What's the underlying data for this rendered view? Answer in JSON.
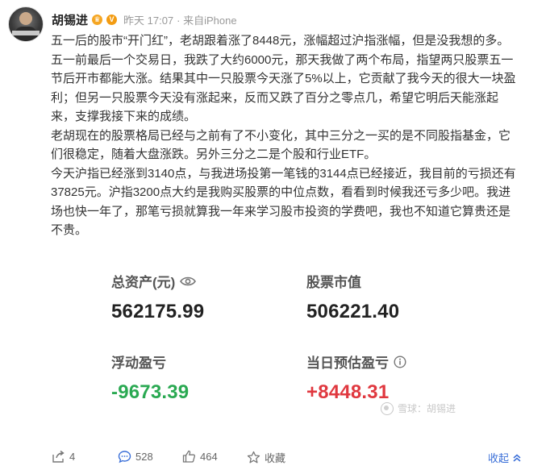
{
  "post": {
    "author": "胡锡进",
    "time": "昨天 17:07",
    "source": "· 来自iPhone",
    "paragraphs": [
      "五一后的股市“开门红”，老胡跟着涨了8448元，涨幅超过沪指涨幅，但是没我想的多。",
      "五一前最后一个交易日，我跌了大约6000元，那天我做了两个布局，指望两只股票五一节后开市都能大涨。结果其中一只股票今天涨了5%以上，它贡献了我今天的很大一块盈利；但另一只股票今天没有涨起来，反而又跌了百分之零点几，希望它明后天能涨起来，支撑我接下来的成绩。",
      "老胡现在的股票格局已经与之前有了不小变化，其中三分之一买的是不同股指基金，它们很稳定，随着大盘涨跌。另外三分之二是个股和行业ETF。",
      "今天沪指已经涨到3140点，与我进场投第一笔钱的3144点已经接近，我目前的亏损还有37825元。沪指3200点大约是我购买股票的中位点数，看看到时候我还亏多少吧。我进场也快一年了，那笔亏损就算我一年来学习股市投资的学费吧，我也不知道它算贵还是不贵。"
    ]
  },
  "stats": {
    "total_assets_label": "总资产(元)",
    "total_assets_value": "562175.99",
    "stock_value_label": "股票市值",
    "stock_value_value": "506221.40",
    "floating_pl_label": "浮动盈亏",
    "floating_pl_value": "-9673.39",
    "daily_pl_label": "当日预估盈亏",
    "daily_pl_value": "+8448.31"
  },
  "watermark": "雪球：胡锡进",
  "actions": {
    "repost_count": "4",
    "comment_count": "528",
    "like_count": "464",
    "favorite_label": "收藏",
    "collapse_label": "收起"
  },
  "colors": {
    "negative_green": "#2aa952",
    "positive_red": "#e0383f",
    "link_blue": "#3a6fd8"
  },
  "icons": [
    "crown-icon",
    "verified-icon",
    "eye-icon",
    "info-icon",
    "share-icon",
    "comment-icon",
    "like-icon",
    "star-icon",
    "chevron-up-icon"
  ]
}
